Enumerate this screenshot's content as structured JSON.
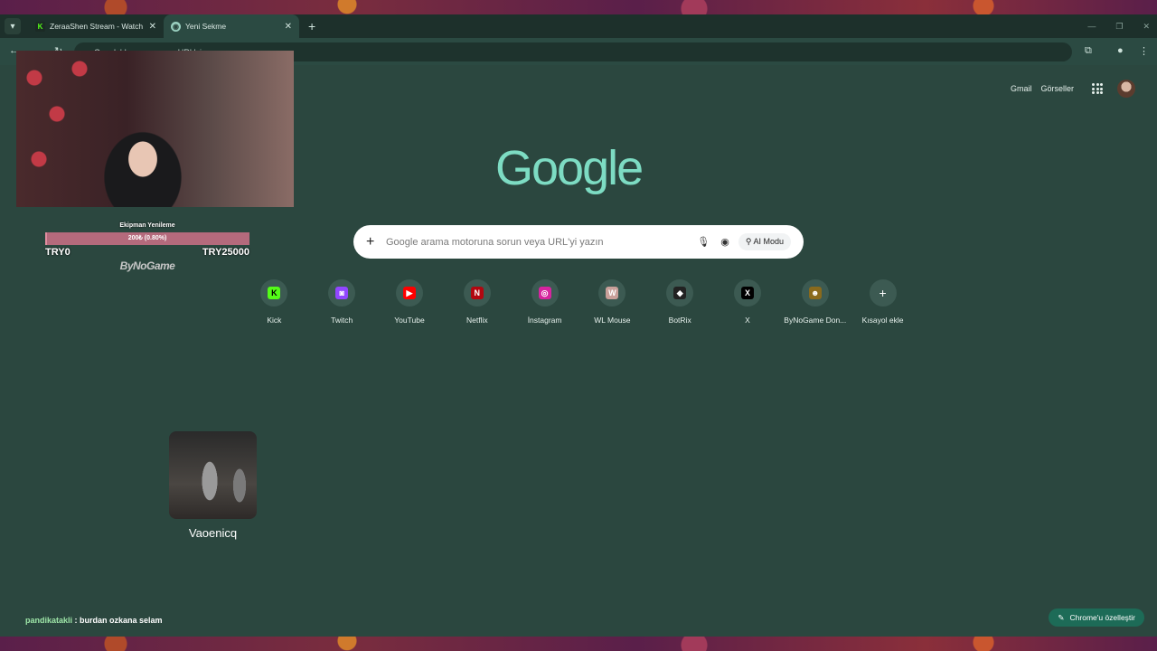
{
  "tabs": [
    {
      "title": "ZeraaShen Stream - Watch Live",
      "favicon": "kick-icon",
      "active": false
    },
    {
      "title": "Yeni Sekme",
      "favicon": "chrome-icon",
      "active": true
    }
  ],
  "omnibox": {
    "text": "Google'da arama veya URL'yi yazın"
  },
  "header": {
    "gmail": "Gmail",
    "images": "Görseller"
  },
  "logo": "Google",
  "search": {
    "placeholder": "Google arama motoruna sorun veya URL'yi yazın",
    "ai_mode": "AI Modu"
  },
  "shortcuts": [
    {
      "label": "Kick",
      "icon": "kick-icon",
      "color": "#53fc18",
      "glyph": "K"
    },
    {
      "label": "Twitch",
      "icon": "twitch-icon",
      "color": "#9146ff",
      "glyph": "◙"
    },
    {
      "label": "YouTube",
      "icon": "youtube-icon",
      "color": "#ff0000",
      "glyph": "▶"
    },
    {
      "label": "Netflix",
      "icon": "netflix-icon",
      "color": "#b20710",
      "glyph": "N"
    },
    {
      "label": "İnstagram",
      "icon": "instagram-icon",
      "color": "#d6249f",
      "glyph": "◎"
    },
    {
      "label": "WL Mouse",
      "icon": "wlmouse-icon",
      "color": "#c9a09a",
      "glyph": "W"
    },
    {
      "label": "BotRix",
      "icon": "botrix-icon",
      "color": "#222222",
      "glyph": "◆"
    },
    {
      "label": "X",
      "icon": "x-icon",
      "color": "#000000",
      "glyph": "X"
    },
    {
      "label": "ByNoGame Don...",
      "icon": "bynogame-icon",
      "color": "#8a6a1c",
      "glyph": "☻"
    },
    {
      "label": "Kısayol ekle",
      "icon": "add-shortcut-icon",
      "color": "transparent",
      "glyph": "+"
    }
  ],
  "goal": {
    "title": "Ekipman Yenileme",
    "progress_text": "200₺ (0.80%)",
    "progress": 0.008,
    "min": "TRY0",
    "max": "TRY25000",
    "logo_text": "ByNoGame"
  },
  "clip": {
    "name": "Vaoenicq"
  },
  "chat": {
    "user": "pandikatakli",
    "message": " : burdan ozkana selam"
  },
  "customize": {
    "label": "Chrome'u özelleştir"
  }
}
